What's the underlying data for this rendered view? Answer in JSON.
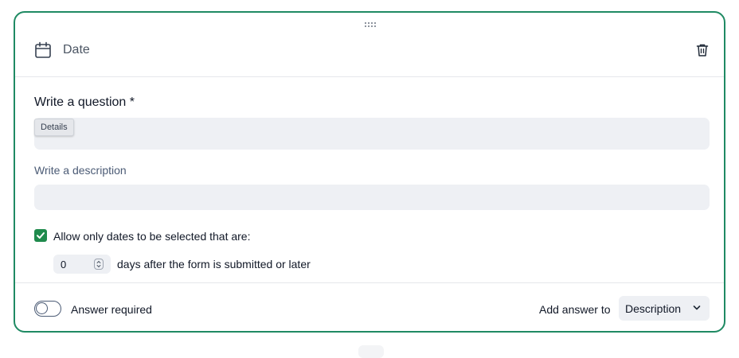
{
  "block": {
    "title": "Date",
    "drag_handle_icon": "drag-dots-icon",
    "type_icon": "calendar-icon",
    "delete_icon": "trash-icon"
  },
  "question": {
    "label": "Write a question *",
    "value": "",
    "tooltip": "Details"
  },
  "description": {
    "label": "Write a description",
    "value": ""
  },
  "date_restriction": {
    "checked": true,
    "label": "Allow only dates to be selected that are:",
    "days_value": "0",
    "days_suffix": "days after the form is submitted or later"
  },
  "footer": {
    "required_label": "Answer required",
    "required_on": false,
    "add_answer_label": "Add answer to",
    "add_answer_selected": "Description"
  },
  "colors": {
    "accent_border": "#1f8a63",
    "checkbox": "#1f8a4c",
    "input_bg": "#eef0f4"
  }
}
